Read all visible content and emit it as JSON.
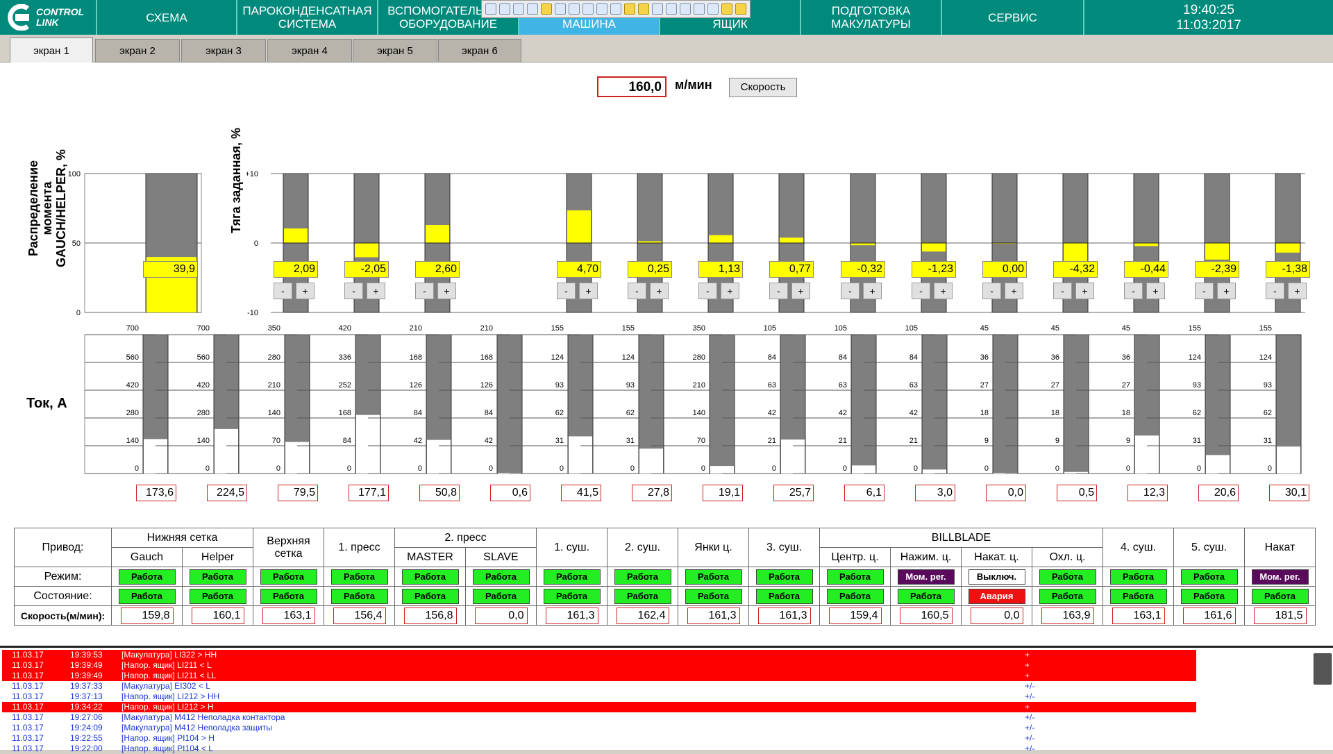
{
  "nav": {
    "logo_line1": "CONTROL",
    "logo_line2": "LINK",
    "items": [
      {
        "label": "СХЕМА"
      },
      {
        "label": "ПАРОКОНДЕНСАТНАЯ\nСИСТЕМА"
      },
      {
        "label": "ВСПОМОГАТЕЛЬНОЕ\nОБОРУДОВАНИЕ"
      },
      {
        "label": "\nМАШИНА"
      },
      {
        "label": "\nЯЩИК"
      },
      {
        "label": "ПОДГОТОВКА\nМАКУЛАТУРЫ"
      },
      {
        "label": "СЕРВИС"
      }
    ],
    "time": "19:40:25",
    "date": "11:03:2017",
    "accent": "#008a7c",
    "active_color": "#41b4e6"
  },
  "tabs": [
    {
      "label": "экран 1"
    },
    {
      "label": "экран 2"
    },
    {
      "label": "экран 3"
    },
    {
      "label": "экран 4"
    },
    {
      "label": "экран 5"
    },
    {
      "label": "экран 6"
    }
  ],
  "speed": {
    "value": "160,0",
    "unit": "м/мин",
    "button": "Скорость"
  },
  "distribution": {
    "label": "Распределение момента\nGAUCH/HELPER, %",
    "ticks": [
      "100",
      "50",
      "0"
    ],
    "value": 39.9,
    "display": "39,9",
    "max": 100
  },
  "tension": {
    "label": "Тяга заданная, %",
    "ticks": [
      "+10",
      "0",
      "-10"
    ],
    "min": -10,
    "max": 10,
    "values": [
      2.09,
      -2.05,
      2.6,
      4.7,
      0.25,
      1.13,
      0.77,
      -0.32,
      -1.23,
      0.0,
      -4.32,
      -0.44,
      -2.39,
      -1.38
    ],
    "display": [
      "2,09",
      "-2,05",
      "2,60",
      "4,70",
      "0,25",
      "1,13",
      "0,77",
      "-0,32",
      "-1,23",
      "0,00",
      "-4,32",
      "-0,44",
      "-2,39",
      "-1,38"
    ],
    "minus": "-",
    "plus": "+"
  },
  "current": {
    "label": "Ток, А",
    "maxes": [
      700,
      700,
      350,
      420,
      210,
      210,
      155,
      155,
      350,
      105,
      105,
      105,
      45,
      45,
      45,
      155,
      155
    ],
    "scales": [
      [
        "700",
        "560",
        "420",
        "280",
        "140",
        "0"
      ],
      [
        "700",
        "560",
        "420",
        "280",
        "140",
        "0"
      ],
      [
        "350",
        "280",
        "210",
        "140",
        "70",
        "0"
      ],
      [
        "420",
        "336",
        "252",
        "168",
        "84",
        "0"
      ],
      [
        "210",
        "168",
        "126",
        "84",
        "42",
        "0"
      ],
      [
        "210",
        "168",
        "126",
        "84",
        "42",
        "0"
      ],
      [
        "155",
        "124",
        "93",
        "62",
        "31",
        "0"
      ],
      [
        "155",
        "124",
        "93",
        "62",
        "31",
        "0"
      ],
      [
        "350",
        "280",
        "210",
        "140",
        "70",
        "0"
      ],
      [
        "105",
        "84",
        "63",
        "42",
        "21",
        "0"
      ],
      [
        "105",
        "84",
        "63",
        "42",
        "21",
        "0"
      ],
      [
        "105",
        "84",
        "63",
        "42",
        "21",
        "0"
      ],
      [
        "45",
        "36",
        "27",
        "18",
        "9",
        "0"
      ],
      [
        "45",
        "36",
        "27",
        "18",
        "9",
        "0"
      ],
      [
        "45",
        "36",
        "27",
        "18",
        "9",
        "0"
      ],
      [
        "155",
        "124",
        "93",
        "62",
        "31",
        "0"
      ],
      [
        "155",
        "124",
        "93",
        "62",
        "31",
        "0"
      ]
    ],
    "values": [
      173.6,
      224.5,
      79.5,
      177.1,
      50.8,
      0.6,
      41.5,
      27.8,
      19.1,
      25.7,
      6.1,
      3.0,
      0.0,
      0.5,
      12.3,
      20.6,
      30.1
    ],
    "display": [
      "173,6",
      "224,5",
      "79,5",
      "177,1",
      "50,8",
      "0,6",
      "41,5",
      "27,8",
      "19,1",
      "25,7",
      "6,1",
      "3,0",
      "0,0",
      "0,5",
      "12,3",
      "20,6",
      "30,1"
    ]
  },
  "drives": {
    "row_labels": [
      "Привод:",
      "Режим:",
      "Состояние:",
      "Скорость(м/мин):"
    ],
    "groups": {
      "lower_wire": "Нижняя сетка",
      "upper_wire": "Верхняя\nсетка",
      "press1": "1. пресс",
      "press2": "2. пресс",
      "dry1": "1. суш.",
      "dry2": "2. суш.",
      "yankee": "Янки ц.",
      "dry3": "3. суш.",
      "billblade": "BILLBLADE",
      "dry4": "4. суш.",
      "dry5": "5. суш.",
      "reel": "Накат"
    },
    "subs": [
      "Gauch",
      "Helper",
      "MASTER",
      "SLAVE",
      "Центр. ц.",
      "Нажим. ц.",
      "Накат. ц.",
      "Охл. ц."
    ],
    "mode": [
      "Работа",
      "Работа",
      "Работа",
      "Работа",
      "Работа",
      "Работа",
      "Работа",
      "Работа",
      "Работа",
      "Работа",
      "Работа",
      "Мом. рег.",
      "Выключ.",
      "Работа",
      "Работа",
      "Работа",
      "Мом. рег."
    ],
    "mode_kind": [
      "ok",
      "ok",
      "ok",
      "ok",
      "ok",
      "ok",
      "ok",
      "ok",
      "ok",
      "ok",
      "ok",
      "moment",
      "off",
      "ok",
      "ok",
      "ok",
      "moment"
    ],
    "state": [
      "Работа",
      "Работа",
      "Работа",
      "Работа",
      "Работа",
      "Работа",
      "Работа",
      "Работа",
      "Работа",
      "Работа",
      "Работа",
      "Работа",
      "Авария",
      "Работа",
      "Работа",
      "Работа",
      "Работа"
    ],
    "state_kind": [
      "ok",
      "ok",
      "ok",
      "ok",
      "ok",
      "ok",
      "ok",
      "ok",
      "ok",
      "ok",
      "ok",
      "ok",
      "alarm",
      "ok",
      "ok",
      "ok",
      "ok"
    ],
    "speeds": [
      "159,8",
      "160,1",
      "163,1",
      "156,4",
      "156,8",
      "0,0",
      "161,3",
      "162,4",
      "161,3",
      "161,3",
      "159,4",
      "160,5",
      "0,0",
      "163,9",
      "163,1",
      "161,6",
      "181,5"
    ],
    "colors": {
      "ok": "#22ee22",
      "moment": "#5a0a5a",
      "off": "#ffffff",
      "alarm": "#ee1111"
    }
  },
  "alarms": [
    {
      "date": "11.03.17",
      "time": "19:39:53",
      "text": "[Макулатура] LI322 > HH",
      "flag": "+",
      "kind": "red"
    },
    {
      "date": "11.03.17",
      "time": "19:39:49",
      "text": "[Напор. ящик] LI211 < L",
      "flag": "+",
      "kind": "red"
    },
    {
      "date": "11.03.17",
      "time": "19:39:49",
      "text": "[Напор. ящик] LI211 < LL",
      "flag": "+",
      "kind": "red"
    },
    {
      "date": "11.03.17",
      "time": "19:37:33",
      "text": "[Макулатура] EI302 < L",
      "flag": "+/-",
      "kind": "blue"
    },
    {
      "date": "11.03.17",
      "time": "19:37:13",
      "text": "[Напор. ящик] LI212 > HH",
      "flag": "+/-",
      "kind": "blue"
    },
    {
      "date": "11.03.17",
      "time": "19:34:22",
      "text": "[Напор. ящик] LI212 > H",
      "flag": "+",
      "kind": "red"
    },
    {
      "date": "11.03.17",
      "time": "19:27:06",
      "text": "[Макулатура] M412 Неполадка контактора",
      "flag": "+/-",
      "kind": "blue"
    },
    {
      "date": "11.03.17",
      "time": "19:24:09",
      "text": "[Макулатура] M412 Неполадка защиты",
      "flag": "+/-",
      "kind": "blue"
    },
    {
      "date": "11.03.17",
      "time": "19:22:55",
      "text": "[Напор. ящик] PI104 > H",
      "flag": "+/-",
      "kind": "blue"
    },
    {
      "date": "11.03.17",
      "time": "19:22:00",
      "text": "[Напор. ящик] PI104 < L",
      "flag": "+/-",
      "kind": "blue"
    }
  ]
}
